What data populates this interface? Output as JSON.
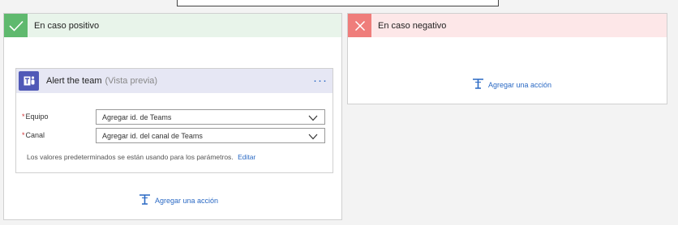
{
  "yes_branch": {
    "title": "En caso positivo",
    "card": {
      "title": "Alert the team",
      "preview": "(Vista previa)",
      "more": "···",
      "fields": [
        {
          "label": "Equipo",
          "required": "*",
          "value": "Agregar id. de Teams"
        },
        {
          "label": "Canal",
          "required": "*",
          "value": "Agregar id. del canal de Teams"
        }
      ],
      "info_text": "Los valores predeterminados se están usando para los parámetros.",
      "edit_link": "Editar"
    },
    "add_action": "Agregar una acción"
  },
  "no_branch": {
    "title": "En caso negativo",
    "add_action": "Agregar una acción"
  },
  "colors": {
    "yes_header": "#e8f4ea",
    "yes_icon": "#5fb96e",
    "no_header": "#fde7e8",
    "no_icon": "#ef7d7b",
    "teams": "#5059b7",
    "link": "#2a69c4"
  },
  "icons": {
    "yes": "check-icon",
    "no": "close-icon",
    "card": "teams-icon",
    "add_action": "add-action-icon",
    "dropdown": "chevron-down-icon"
  }
}
